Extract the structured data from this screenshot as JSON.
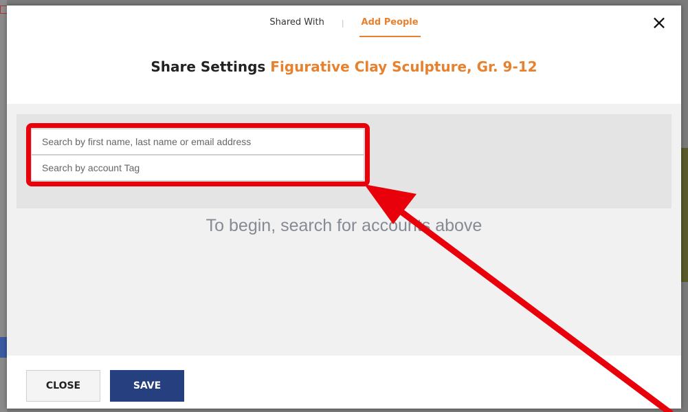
{
  "tabs": [
    {
      "label": "Shared With",
      "active": false
    },
    {
      "label": "Add People",
      "active": true
    }
  ],
  "tab_separator": "|",
  "close_icon": "×",
  "title": {
    "prefix": "Share Settings",
    "resource_name": "Figurative Clay Sculpture, Gr. 9-12"
  },
  "search": {
    "name_placeholder": "Search by first name, last name or email address",
    "tag_placeholder": "Search by account Tag"
  },
  "empty_message": "To begin, search for accounts above",
  "footer": {
    "close_label": "CLOSE",
    "save_label": "SAVE"
  },
  "annotation": {
    "color": "#e8000a",
    "icon": "red-arrow-pointer"
  },
  "colors": {
    "accent": "#e8812e",
    "primary_button": "#253f7f"
  }
}
